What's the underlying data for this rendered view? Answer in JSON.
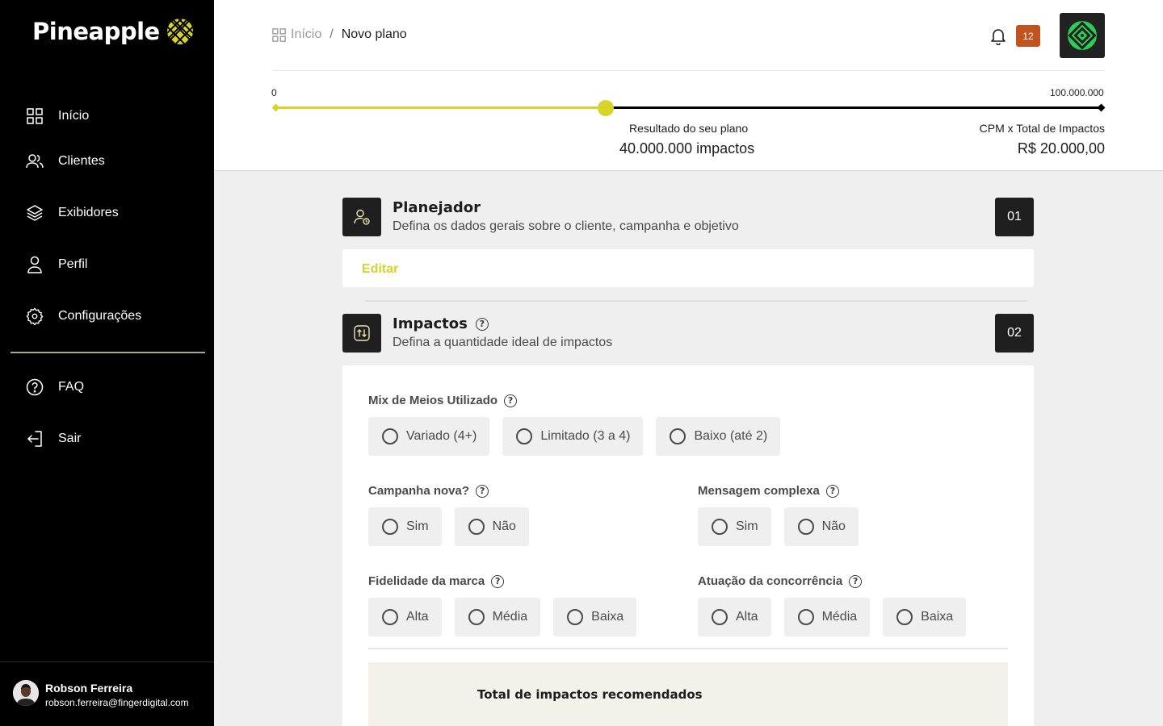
{
  "sidebar": {
    "brand": "Pineapple",
    "items": [
      {
        "label": "Início",
        "icon": "grid-icon"
      },
      {
        "label": "Clientes",
        "icon": "users-icon"
      },
      {
        "label": "Exibidores",
        "icon": "layers-icon"
      },
      {
        "label": "Perfil",
        "icon": "user-icon"
      },
      {
        "label": "Configurações",
        "icon": "gear-icon"
      }
    ],
    "secondary": [
      {
        "label": "FAQ",
        "icon": "help-circle-icon"
      },
      {
        "label": "Sair",
        "icon": "logout-icon"
      }
    ],
    "user": {
      "name": "Robson Ferreira",
      "email": "robson.ferreira@fingerdigital.com"
    }
  },
  "header": {
    "breadcrumb": {
      "home": "Início",
      "separator": "/",
      "current": "Novo plano"
    },
    "notifications_count": "12"
  },
  "impact_slider": {
    "min_label": "0",
    "max_label": "100.000.000",
    "min": 0,
    "max": 100000000,
    "value": 40000000,
    "result_label": "Resultado do seu plano",
    "result_value": "40.000.000 impactos",
    "cpm_label": "CPM x Total de Impactos",
    "cpm_value": "R$ 20.000,00"
  },
  "steps": [
    {
      "title": "Planejador",
      "subtitle": "Defina os dados gerais sobre o cliente, campanha e objetivo",
      "number": "01",
      "edit_label": "Editar"
    },
    {
      "title": "Impactos",
      "subtitle": "Defina a quantidade ideal de impactos",
      "number": "02"
    }
  ],
  "form": {
    "mix": {
      "label": "Mix de Meios Utilizado",
      "options": [
        "Variado (4+)",
        "Limitado (3 a 4)",
        "Baixo (até 2)"
      ]
    },
    "campanha_nova": {
      "label": "Campanha nova?",
      "options": [
        "Sim",
        "Não"
      ]
    },
    "mensagem_complexa": {
      "label": "Mensagem complexa",
      "options": [
        "Sim",
        "Não"
      ]
    },
    "fidelidade": {
      "label": "Fidelidade da marca",
      "options": [
        "Alta",
        "Média",
        "Baixa"
      ]
    },
    "concorrencia": {
      "label": "Atuação da concorrência",
      "options": [
        "Alta",
        "Média",
        "Baixa"
      ]
    },
    "total_title": "Total de impactos recomendados"
  },
  "colors": {
    "accent": "#d6d42a",
    "badge": "#c0531e",
    "sidebar_bg": "#000000",
    "dark_tile": "#1f1f1f"
  }
}
